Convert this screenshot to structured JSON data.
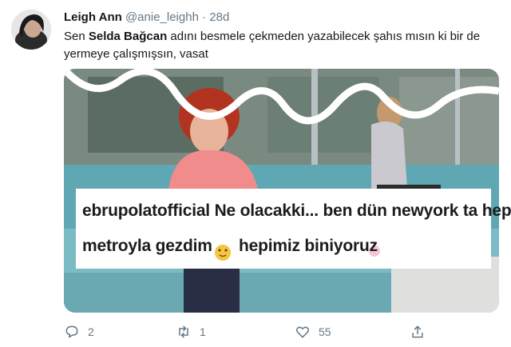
{
  "tweet": {
    "author_name": "Leigh Ann",
    "author_handle": "@anie_leighh",
    "separator": "·",
    "time": "28d",
    "text_before": "Sen ",
    "text_bold": "Selda Bağcan",
    "text_after": " adını besmele çekmeden yazabilecek şahıs mısın ki bir de yermeye çalışmışsın, vasat"
  },
  "media": {
    "overlay_username": "ebrupolatofficial",
    "overlay_line1_rest": " Ne olacakki... ben dün newyork ta hep",
    "overlay_line2_a": "metroyla gezdim ",
    "overlay_line2_b": " hepimiz biniyoruz "
  },
  "actions": {
    "reply_icon": "reply-icon",
    "reply_count": "2",
    "retweet_icon": "retweet-icon",
    "retweet_count": "1",
    "like_icon": "heart-icon",
    "like_count": "55",
    "share_icon": "share-icon"
  },
  "colors": {
    "text_primary": "#14171a",
    "text_secondary": "#657786"
  }
}
